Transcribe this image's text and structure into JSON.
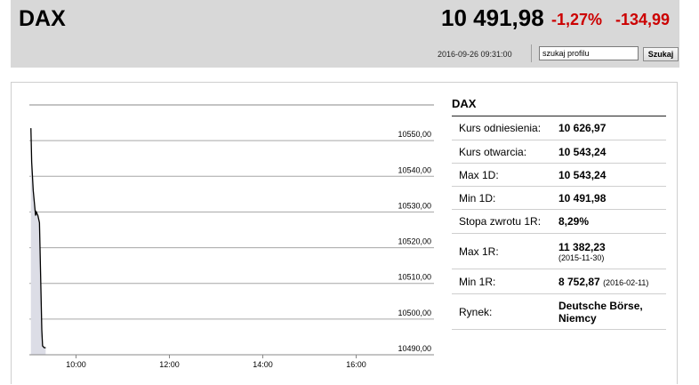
{
  "header": {
    "index_name": "DAX",
    "price": "10 491,98",
    "change_pct": "-1,27%",
    "change_abs": "-134,99",
    "timestamp": "2016-09-26 09:31:00",
    "search_value": "szukaj profilu",
    "search_button": "Szukaj",
    "accent_color": "#cc0000"
  },
  "info": {
    "title": "DAX",
    "rows": [
      {
        "label": "Kurs odniesienia:",
        "value": "10 626,97"
      },
      {
        "label": "Kurs otwarcia:",
        "value": "10 543,24"
      },
      {
        "label": "Max 1D:",
        "value": "10 543,24"
      },
      {
        "label": "Min 1D:",
        "value": "10 491,98"
      },
      {
        "label": "Stopa zwrotu 1R:",
        "value": "8,29%"
      },
      {
        "label": "Max 1R:",
        "value": "11 382,23",
        "note": "(2015-11-30)"
      },
      {
        "label": "Min 1R:",
        "value": "8 752,87",
        "note": "(2016-02-11)"
      },
      {
        "label": "Rynek:",
        "value": "Deutsche Börse,",
        "value2": "Niemcy"
      }
    ]
  },
  "chart_data": {
    "type": "area",
    "x_ticks": [
      "10:00",
      "12:00",
      "14:00",
      "16:00"
    ],
    "y_ticks": [
      "10550,00",
      "10540,00",
      "10530,00",
      "10520,00",
      "10510,00",
      "10500,00",
      "10490,00"
    ],
    "ylim": [
      10490,
      10560
    ],
    "xlim_minutes": [
      540,
      1060
    ],
    "x_tick_minutes": [
      600,
      720,
      840,
      960
    ],
    "y_tick_values": [
      10550,
      10540,
      10530,
      10520,
      10510,
      10500,
      10490
    ],
    "grid": true,
    "points": [
      {
        "t": 542,
        "v": 10553.5
      },
      {
        "t": 543,
        "v": 10544
      },
      {
        "t": 545,
        "v": 10536
      },
      {
        "t": 548,
        "v": 10529
      },
      {
        "t": 549,
        "v": 10530
      },
      {
        "t": 551,
        "v": 10529
      },
      {
        "t": 553,
        "v": 10527
      },
      {
        "t": 556,
        "v": 10497
      },
      {
        "t": 557,
        "v": 10492.5
      },
      {
        "t": 559,
        "v": 10492
      },
      {
        "t": 561,
        "v": 10491.98
      }
    ],
    "line_color": "#000000",
    "fill_color": "#dcdde6"
  }
}
